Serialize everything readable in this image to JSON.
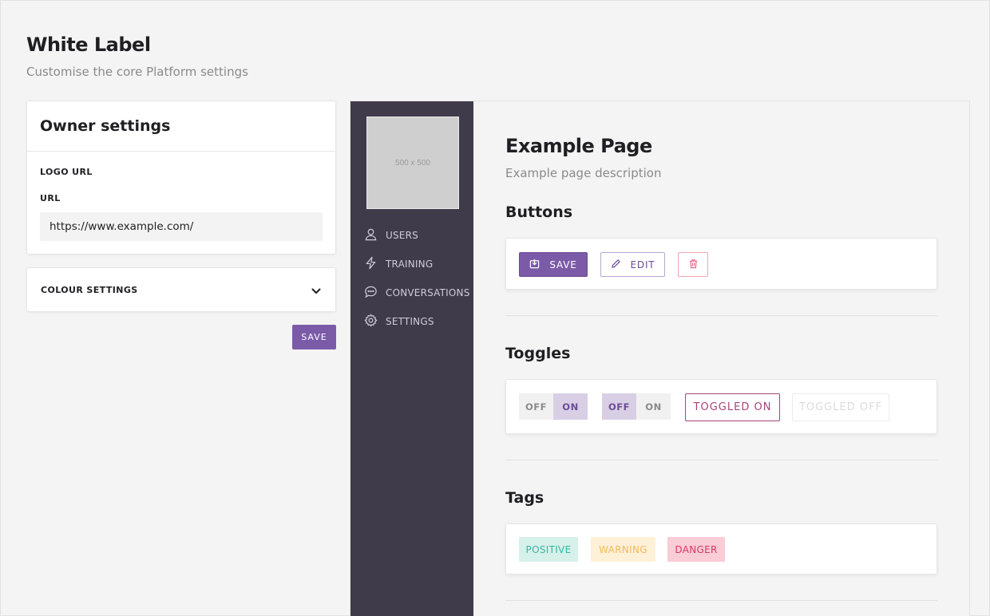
{
  "header": {
    "title": "White Label",
    "subtitle": "Customise the core Platform settings"
  },
  "owner_settings": {
    "title": "Owner settings",
    "logo_url_label": "LOGO URL",
    "url_label": "URL",
    "url_value": "https://www.example.com/"
  },
  "colour_settings": {
    "label": "COLOUR SETTINGS",
    "icon": "chevron-down-icon"
  },
  "save_label": "SAVE",
  "preview": {
    "logo_placeholder": "500 x 500",
    "nav": [
      {
        "label": "USERS",
        "icon": "users-icon"
      },
      {
        "label": "TRAINING",
        "icon": "lightning-icon"
      },
      {
        "label": "CONVERSATIONS",
        "icon": "chat-icon"
      },
      {
        "label": "SETTINGS",
        "icon": "gear-icon"
      }
    ],
    "page_title": "Example Page",
    "page_description": "Example page description",
    "buttons_title": "Buttons",
    "buttons": {
      "save": "SAVE",
      "edit": "EDIT",
      "delete_icon": "trash-icon"
    },
    "toggles_title": "Toggles",
    "toggles": {
      "group1": {
        "off": "OFF",
        "on": "ON",
        "selected": "ON"
      },
      "group2": {
        "off": "OFF",
        "on": "ON",
        "selected": "OFF"
      },
      "toggled_on": "TOGGLED ON",
      "toggled_off": "TOGGLED OFF"
    },
    "tags_title": "Tags",
    "tags": {
      "positive": "POSITIVE",
      "warning": "WARNING",
      "danger": "DANGER"
    }
  },
  "colors": {
    "accent": "#7b5ba8",
    "sidebar": "#403b4b",
    "positive": "#35b8a0",
    "warning": "#f1bc5e",
    "danger": "#d33a63"
  }
}
